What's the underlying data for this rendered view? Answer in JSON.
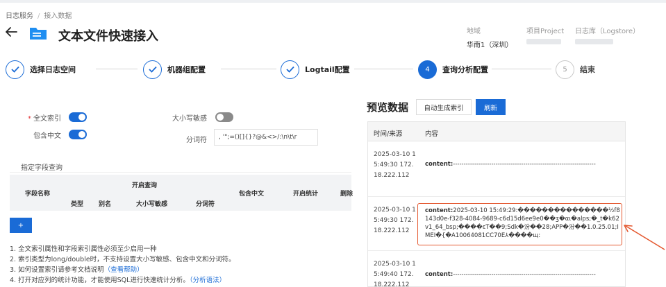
{
  "breadcrumb": {
    "items": [
      "日志服务",
      "接入数据"
    ]
  },
  "header": {
    "title": "文本文件快速接入"
  },
  "meta": {
    "region": {
      "label": "地域",
      "value": "华南1（深圳）"
    },
    "project": {
      "label": "项目Project"
    },
    "logstore": {
      "label": "日志库（Logstore）"
    }
  },
  "steps": [
    {
      "label": "选择日志空间",
      "state": "done"
    },
    {
      "label": "机器组配置",
      "state": "done"
    },
    {
      "label": "Logtail配置",
      "state": "done"
    },
    {
      "label": "查询分析配置",
      "state": "active",
      "number": "4"
    },
    {
      "label": "结束",
      "state": "pending",
      "number": "5"
    }
  ],
  "index_config": {
    "fulltext_label": "全文索引",
    "fulltext_required_mark": "*",
    "fulltext_on": true,
    "include_cn_label": "包含中文",
    "include_cn_on": true,
    "case_label": "大小写敏感",
    "case_on": false,
    "delimiter_label": "分词符",
    "delimiter_value": ", '\";=()[]{}?@&<>/:\\n\\t\\r"
  },
  "field_query": {
    "section_title": "指定字段查询",
    "headers": {
      "field_name": "字段名称",
      "enable_query": "开启查询",
      "type": "类型",
      "alias": "别名",
      "case_sensitive": "大小写敏感",
      "delimiter": "分词符",
      "include_cn": "包含中文",
      "enable_stats": "开启统计",
      "delete": "删除"
    },
    "add_label": "+"
  },
  "notes": [
    {
      "text": "1. 全文索引属性和字段索引属性必须至少启用一种"
    },
    {
      "text": "2. 索引类型为long/double时，不支持设置大小写敏感、包含中文和分词符。"
    },
    {
      "text": "3. 如何设置索引请参考文档说明",
      "link": "（查看帮助）"
    },
    {
      "text": "4. 打开对应列的统计功能，才能使用SQL进行快速统计分析。",
      "link": "（分析语法）"
    }
  ],
  "preview": {
    "title": "预览数据",
    "auto_index_label": "自动生成索引",
    "refresh_label": "刷新",
    "col_time": "时间/来源",
    "col_content": "内容",
    "rows": [
      {
        "time": "2025-03-10 15:49:30 172.18.222.112",
        "content_key": "content:",
        "content_value": "-------------------------------------------------------------------"
      },
      {
        "time": "2025-03-10 15:49:30 172.18.222.112",
        "content_key": "content:",
        "content_value": "2025-03-10 15:49:29:���������������½f8143d0e-f328-4084-9689-c6d15d6ee9e0��ʒ�αι�alps;�_t�k62v1_64_bsp;����εΤ��9;Sdk�汾��28;APP�汾��1.0.25.01;IMEI�{�A10064081CC70E⅄����щ:"
      },
      {
        "time": "2025-03-10 15:49:40 172.18.222.112",
        "content_key": "content:",
        "content_value": "-------------------------------------------------------------------"
      }
    ]
  }
}
